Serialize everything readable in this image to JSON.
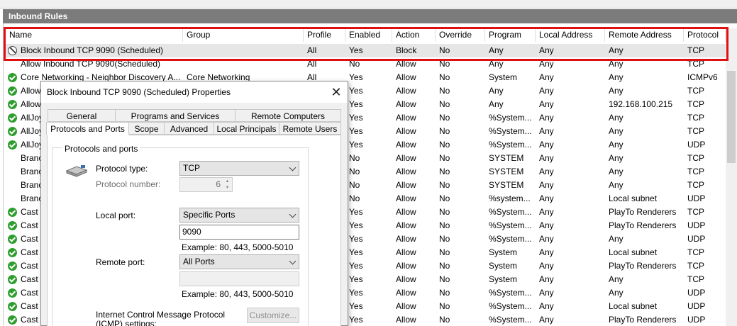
{
  "panel": {
    "title": "Inbound Rules"
  },
  "columns": [
    "Name",
    "Group",
    "Profile",
    "Enabled",
    "Action",
    "Override",
    "Program",
    "Local Address",
    "Remote Address",
    "Protocol"
  ],
  "rows": [
    {
      "icon": "block",
      "name": "Block Inbound TCP 9090 (Scheduled)",
      "group": "",
      "profile": "All",
      "enabled": "Yes",
      "action": "Block",
      "override": "No",
      "program": "Any",
      "local": "Any",
      "remote": "Any",
      "protocol": "TCP"
    },
    {
      "icon": "none",
      "name": "Allow Inbound TCP 9090(Scheduled)",
      "group": "",
      "profile": "All",
      "enabled": "No",
      "action": "Allow",
      "override": "No",
      "program": "Any",
      "local": "Any",
      "remote": "Any",
      "protocol": "TCP"
    },
    {
      "icon": "ok",
      "name": "Core Networking - Neighbor Discovery A...",
      "group": "Core Networking",
      "profile": "All",
      "enabled": "Yes",
      "action": "Allow",
      "override": "No",
      "program": "System",
      "local": "Any",
      "remote": "Any",
      "protocol": "ICMPv6"
    },
    {
      "icon": "ok",
      "name": "Allow",
      "group": "",
      "profile": "",
      "enabled": "Yes",
      "action": "Allow",
      "override": "No",
      "program": "Any",
      "local": "Any",
      "remote": "Any",
      "protocol": "TCP"
    },
    {
      "icon": "ok",
      "name": "Allow",
      "group": "",
      "profile": "",
      "enabled": "Yes",
      "action": "Allow",
      "override": "No",
      "program": "Any",
      "local": "Any",
      "remote": "192.168.100.215",
      "protocol": "TCP"
    },
    {
      "icon": "ok",
      "name": "AllJoy",
      "group": "",
      "profile": "",
      "enabled": "Yes",
      "action": "Allow",
      "override": "No",
      "program": "%System...",
      "local": "Any",
      "remote": "Any",
      "protocol": "TCP"
    },
    {
      "icon": "ok",
      "name": "AllJoy",
      "group": "",
      "profile": "",
      "enabled": "Yes",
      "action": "Allow",
      "override": "No",
      "program": "%System...",
      "local": "Any",
      "remote": "Any",
      "protocol": "TCP"
    },
    {
      "icon": "ok",
      "name": "AllJoy",
      "group": "",
      "profile": "",
      "enabled": "Yes",
      "action": "Allow",
      "override": "No",
      "program": "%System...",
      "local": "Any",
      "remote": "Any",
      "protocol": "UDP"
    },
    {
      "icon": "none",
      "name": "Branc",
      "group": "",
      "profile": "",
      "enabled": "No",
      "action": "Allow",
      "override": "No",
      "program": "SYSTEM",
      "local": "Any",
      "remote": "Any",
      "protocol": "TCP"
    },
    {
      "icon": "none",
      "name": "Branc",
      "group": "",
      "profile": "",
      "enabled": "No",
      "action": "Allow",
      "override": "No",
      "program": "SYSTEM",
      "local": "Any",
      "remote": "Any",
      "protocol": "TCP"
    },
    {
      "icon": "none",
      "name": "Branc",
      "group": "",
      "profile": "",
      "enabled": "No",
      "action": "Allow",
      "override": "No",
      "program": "SYSTEM",
      "local": "Any",
      "remote": "Any",
      "protocol": "TCP"
    },
    {
      "icon": "none",
      "name": "Branc",
      "group": "",
      "profile": "",
      "enabled": "No",
      "action": "Allow",
      "override": "No",
      "program": "%system...",
      "local": "Any",
      "remote": "Local subnet",
      "protocol": "UDP"
    },
    {
      "icon": "ok",
      "name": "Cast t",
      "group": "",
      "profile": "",
      "enabled": "Yes",
      "action": "Allow",
      "override": "No",
      "program": "%System...",
      "local": "Any",
      "remote": "PlayTo Renderers",
      "protocol": "TCP"
    },
    {
      "icon": "ok",
      "name": "Cast t",
      "group": "",
      "profile": "",
      "enabled": "Yes",
      "action": "Allow",
      "override": "No",
      "program": "%System...",
      "local": "Any",
      "remote": "PlayTo Renderers",
      "protocol": "UDP"
    },
    {
      "icon": "ok",
      "name": "Cast t",
      "group": "",
      "profile": "",
      "enabled": "Yes",
      "action": "Allow",
      "override": "No",
      "program": "%System...",
      "local": "Any",
      "remote": "Any",
      "protocol": "UDP"
    },
    {
      "icon": "ok",
      "name": "Cast t",
      "group": "",
      "profile": "",
      "enabled": "Yes",
      "action": "Allow",
      "override": "No",
      "program": "System",
      "local": "Any",
      "remote": "Local subnet",
      "protocol": "TCP"
    },
    {
      "icon": "ok",
      "name": "Cast t",
      "group": "",
      "profile": "",
      "enabled": "Yes",
      "action": "Allow",
      "override": "No",
      "program": "System",
      "local": "Any",
      "remote": "PlayTo Renderers",
      "protocol": "TCP"
    },
    {
      "icon": "ok",
      "name": "Cast t",
      "group": "",
      "profile": "",
      "enabled": "Yes",
      "action": "Allow",
      "override": "No",
      "program": "System",
      "local": "Any",
      "remote": "Any",
      "protocol": "TCP"
    },
    {
      "icon": "ok",
      "name": "Cast t",
      "group": "",
      "profile": "",
      "enabled": "Yes",
      "action": "Allow",
      "override": "No",
      "program": "%System...",
      "local": "Any",
      "remote": "Any",
      "protocol": "UDP"
    },
    {
      "icon": "ok",
      "name": "Cast t",
      "group": "",
      "profile": "",
      "enabled": "Yes",
      "action": "Allow",
      "override": "No",
      "program": "%System...",
      "local": "Any",
      "remote": "Local subnet",
      "protocol": "UDP"
    },
    {
      "icon": "ok",
      "name": "Cast t",
      "group": "",
      "profile": "",
      "enabled": "Yes",
      "action": "Allow",
      "override": "No",
      "program": "%System...",
      "local": "Any",
      "remote": "PlayTo Renderers",
      "protocol": "UDP"
    }
  ],
  "dialog": {
    "title": "Block Inbound TCP 9090 (Scheduled) Properties",
    "tabs_row1": [
      "General",
      "Programs and Services",
      "Remote Computers"
    ],
    "tabs_row2": [
      "Protocols and Ports",
      "Scope",
      "Advanced",
      "Local Principals",
      "Remote Users"
    ],
    "group_label": "Protocols and ports",
    "protocol_type_label": "Protocol type:",
    "protocol_type_value": "TCP",
    "protocol_number_label": "Protocol number:",
    "protocol_number_value": "6",
    "local_port_label": "Local port:",
    "local_port_mode": "Specific Ports",
    "local_port_value": "9090",
    "local_example": "Example: 80, 443, 5000-5010",
    "remote_port_label": "Remote port:",
    "remote_port_mode": "All Ports",
    "remote_port_value": "",
    "remote_example": "Example: 80, 443, 5000-5010",
    "icmp_label_1": "Internet Control Message Protocol",
    "icmp_label_2": "(ICMP) settings:",
    "customize_label": "Customize..."
  },
  "colors": {
    "highlight": "#e01010",
    "panel_header": "#7b7b7b",
    "allow_icon": "#2e9e2e"
  }
}
